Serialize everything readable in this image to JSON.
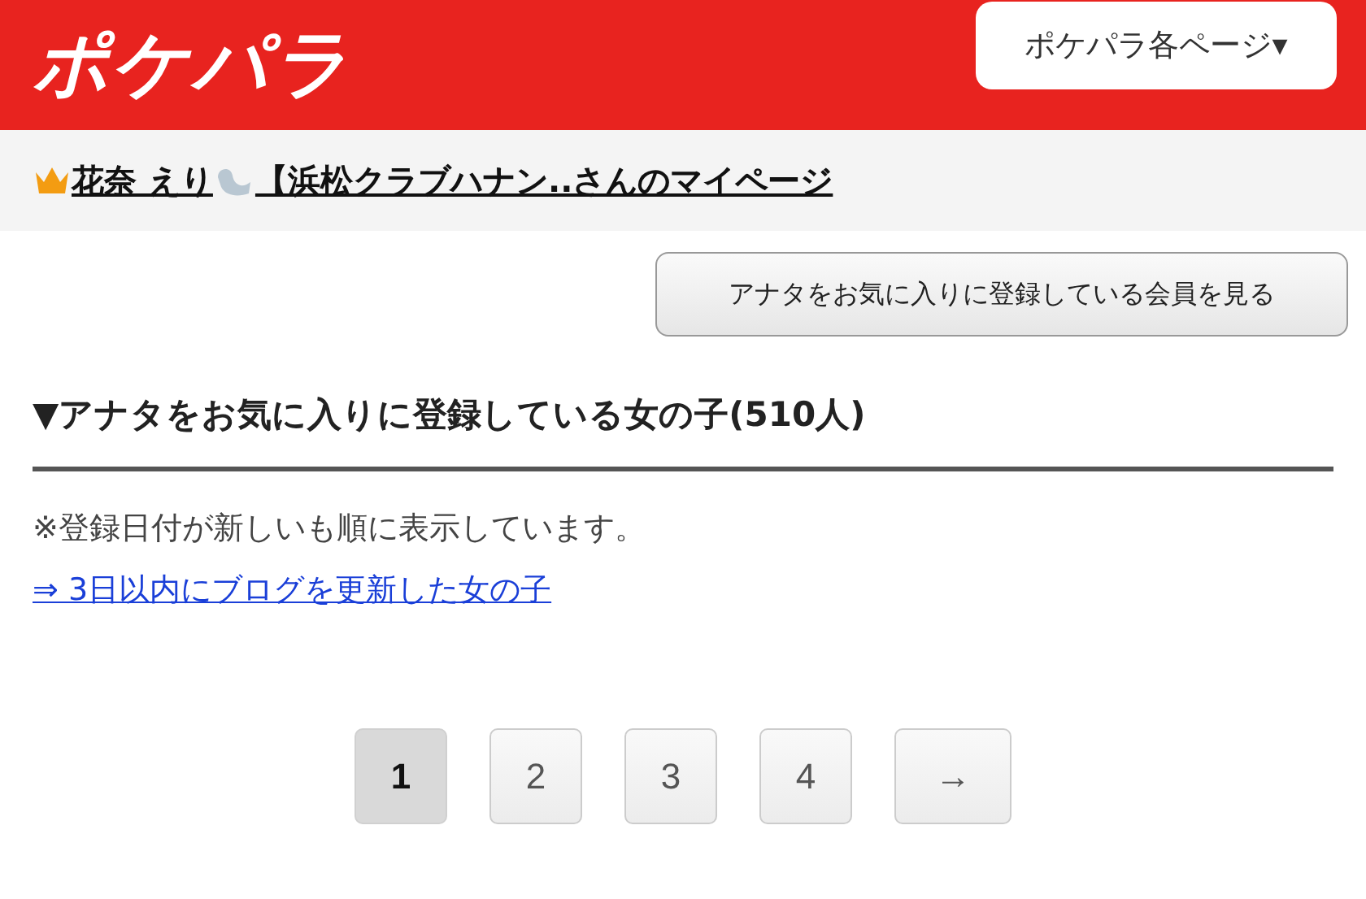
{
  "header": {
    "logo": "ポケパラ",
    "menu_button": "ポケパラ各ページ▾"
  },
  "mypage_link": {
    "name": "花奈 えり",
    "rest": "【浜松クラブハナン..さんのマイページ"
  },
  "view_members_button": "アナタをお気に入りに登録している会員を見る",
  "section": {
    "heading": "▼アナタをお気に入りに登録している女の子(510人)",
    "note": "※登録日付が新しいも順に表示しています。",
    "link": "⇒ 3日以内にブログを更新した女の子"
  },
  "pagination": [
    {
      "label": "1",
      "selected": true
    },
    {
      "label": "2",
      "selected": false
    },
    {
      "label": "3",
      "selected": false
    },
    {
      "label": "4",
      "selected": false
    },
    {
      "label": "→",
      "selected": false
    }
  ]
}
